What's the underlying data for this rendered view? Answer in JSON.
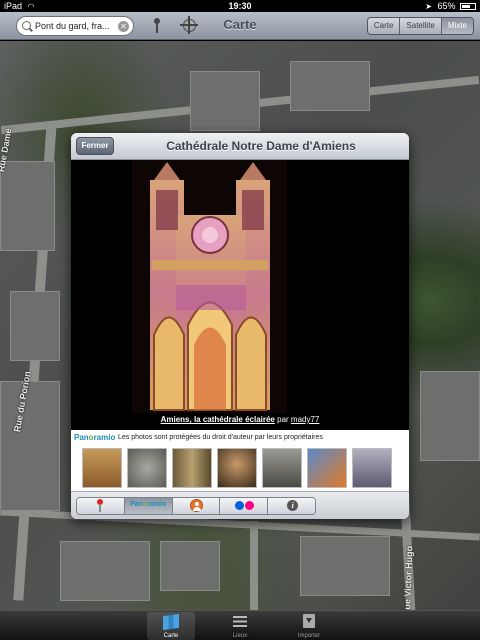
{
  "status_bar": {
    "device": "iPad",
    "time": "19:30",
    "battery": "65%"
  },
  "toolbar": {
    "search_value": "Pont du gard, fra...",
    "title": "Carte",
    "map_types": [
      "Carte",
      "Satellite",
      "Mixte"
    ],
    "active_map_type": "Mixte"
  },
  "map": {
    "street_labels": [
      "Rue Dame",
      "Rue du Porion",
      "Rue Victor Hugo"
    ]
  },
  "popup": {
    "close_label": "Fermer",
    "title": "Cathédrale Notre Dame d'Amiens",
    "caption_title": "Amiens, la cathédrale éclairée",
    "caption_by": "par",
    "caption_author": "mady77",
    "panoramio_logo_a": "Pan",
    "panoramio_logo_o": "o",
    "panoramio_logo_b": "ramio",
    "copyright_notice": "Les photos sont protégées du droit d'auteur par leurs propriétaires",
    "thumbnail_count": 7,
    "tabs": [
      "map-pin",
      "Panoramio",
      "person",
      "flickr",
      "info"
    ],
    "active_tab": "Panoramio"
  },
  "bottom_tabs": [
    {
      "label": "Carte",
      "icon": "map-icon"
    },
    {
      "label": "Lieux",
      "icon": "list-icon"
    },
    {
      "label": "Importer",
      "icon": "import-icon"
    }
  ],
  "colors": {
    "panoramio_blue": "#1b8fb8",
    "panoramio_green": "#6aa84f",
    "flickr_blue": "#0063dc",
    "flickr_pink": "#ff0084"
  }
}
